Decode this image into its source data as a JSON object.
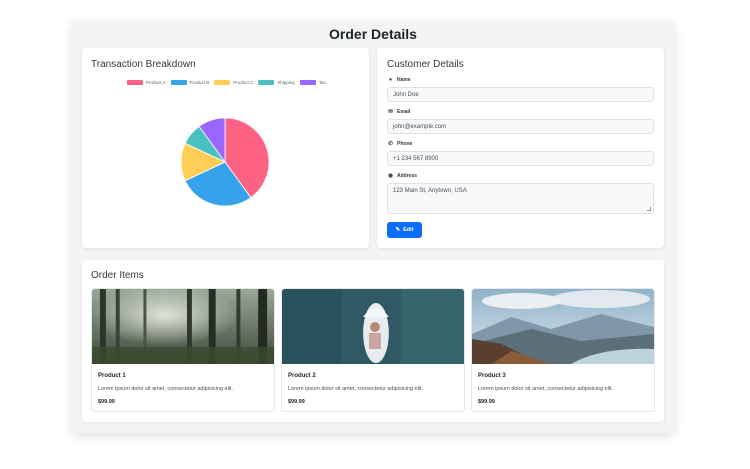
{
  "page": {
    "title": "Order Details"
  },
  "transaction": {
    "title": "Transaction Breakdown",
    "chart_data": {
      "type": "pie",
      "title": "",
      "categories": [
        "Product A",
        "Product B",
        "Product C",
        "Shipping",
        "Tax"
      ],
      "values": [
        40,
        28,
        14,
        8,
        10
      ],
      "colors": [
        "#ff6384",
        "#36a2eb",
        "#ffce56",
        "#4bc0c0",
        "#9966ff"
      ],
      "legend_position": "top"
    }
  },
  "customer": {
    "title": "Customer Details",
    "fields": [
      {
        "label": "Name",
        "value": "John Doe",
        "icon": "user-icon"
      },
      {
        "label": "Email",
        "value": "john@example.com",
        "icon": "envelope-icon"
      },
      {
        "label": "Phone",
        "value": "+1 234 567 8900",
        "icon": "phone-icon"
      },
      {
        "label": "Address",
        "value": "123 Main St, Anytown, USA",
        "icon": "map-marker-icon"
      }
    ],
    "edit_label": "Edit",
    "edit_icon": "edit-icon"
  },
  "order_items": {
    "title": "Order Items",
    "products": [
      {
        "name": "Product 1",
        "description": "Lorem ipsum dolor sit amet, consectetur adipisicing elit.",
        "price": "$99.99",
        "image": "forest-image"
      },
      {
        "name": "Product 2",
        "description": "Lorem ipsum dolor sit amet, consectetur adipisicing elit.",
        "price": "$99.99",
        "image": "lake-portrait-image"
      },
      {
        "name": "Product 3",
        "description": "Lorem ipsum dolor sit amet, consectetur adipisicing elit.",
        "price": "$99.99",
        "image": "mountain-valley-image"
      }
    ]
  }
}
